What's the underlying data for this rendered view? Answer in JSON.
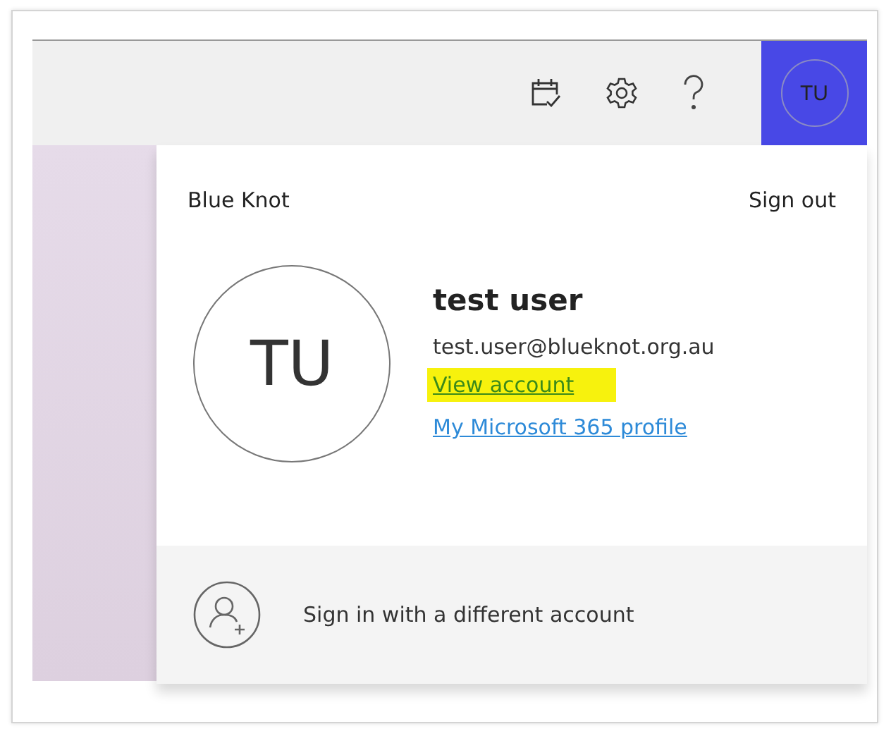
{
  "header": {
    "avatar_initials": "TU"
  },
  "account_panel": {
    "organization": "Blue Knot",
    "sign_out": "Sign out",
    "avatar_initials": "TU",
    "name": "test user",
    "email": "test.user@blueknot.org.au",
    "links": [
      {
        "label": "View account",
        "highlighted": true
      },
      {
        "label": "My Microsoft 365 profile",
        "highlighted": false
      }
    ],
    "other_account": "Sign in with a different account"
  }
}
